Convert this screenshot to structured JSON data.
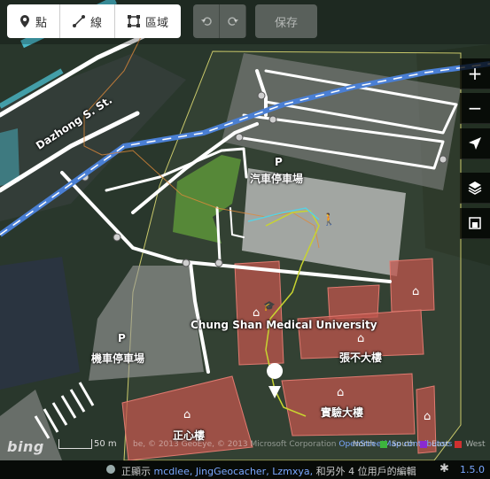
{
  "toolbar": {
    "modes": [
      {
        "label": "點",
        "icon": "point-icon"
      },
      {
        "label": "線",
        "icon": "line-icon"
      },
      {
        "label": "區域",
        "icon": "area-icon"
      }
    ],
    "save_label": "保存"
  },
  "map_controls": [
    {
      "name": "zoom-in-button",
      "glyph": "+"
    },
    {
      "name": "zoom-out-button",
      "glyph": "−"
    },
    {
      "name": "geolocate-button",
      "glyph": "➤"
    },
    {
      "name": "layers-button",
      "glyph": "≋"
    },
    {
      "name": "map-data-button",
      "glyph": "▣"
    }
  ],
  "map_labels": {
    "street": "Dazhong S. St.",
    "car_parking": "汽車停車場",
    "moto_parking": "機車停車場",
    "university": "Chung Shan Medical University",
    "zhengxin": "正心樓",
    "zhangbuda": "張不大樓",
    "shiyan": "實驗大樓",
    "parking_marker": "P"
  },
  "attribution": {
    "brand": "bing",
    "scale": "50 m",
    "source_text": "be, © 2013 GeoEye, © 2013 Microsoft Corporation ",
    "osm_link": "OpenStreetMap contributors",
    "legend": {
      "north": "North",
      "south": "South",
      "east": "East",
      "west": "West"
    }
  },
  "status": {
    "prefix": "正顯示",
    "users": "mcdlee, JingGeocacher, Lzmxya,",
    "suffix": "和另外 4 位用戶的編輯",
    "version": "1.5.0"
  },
  "colors": {
    "building_fill": "#c0564d",
    "parking_fill": "#b8b8b8",
    "park_fill": "#5f9a3a",
    "road_blue": "#4a7fd4",
    "teal": "#4ab8c8",
    "accent_link": "#7aa7ff"
  }
}
